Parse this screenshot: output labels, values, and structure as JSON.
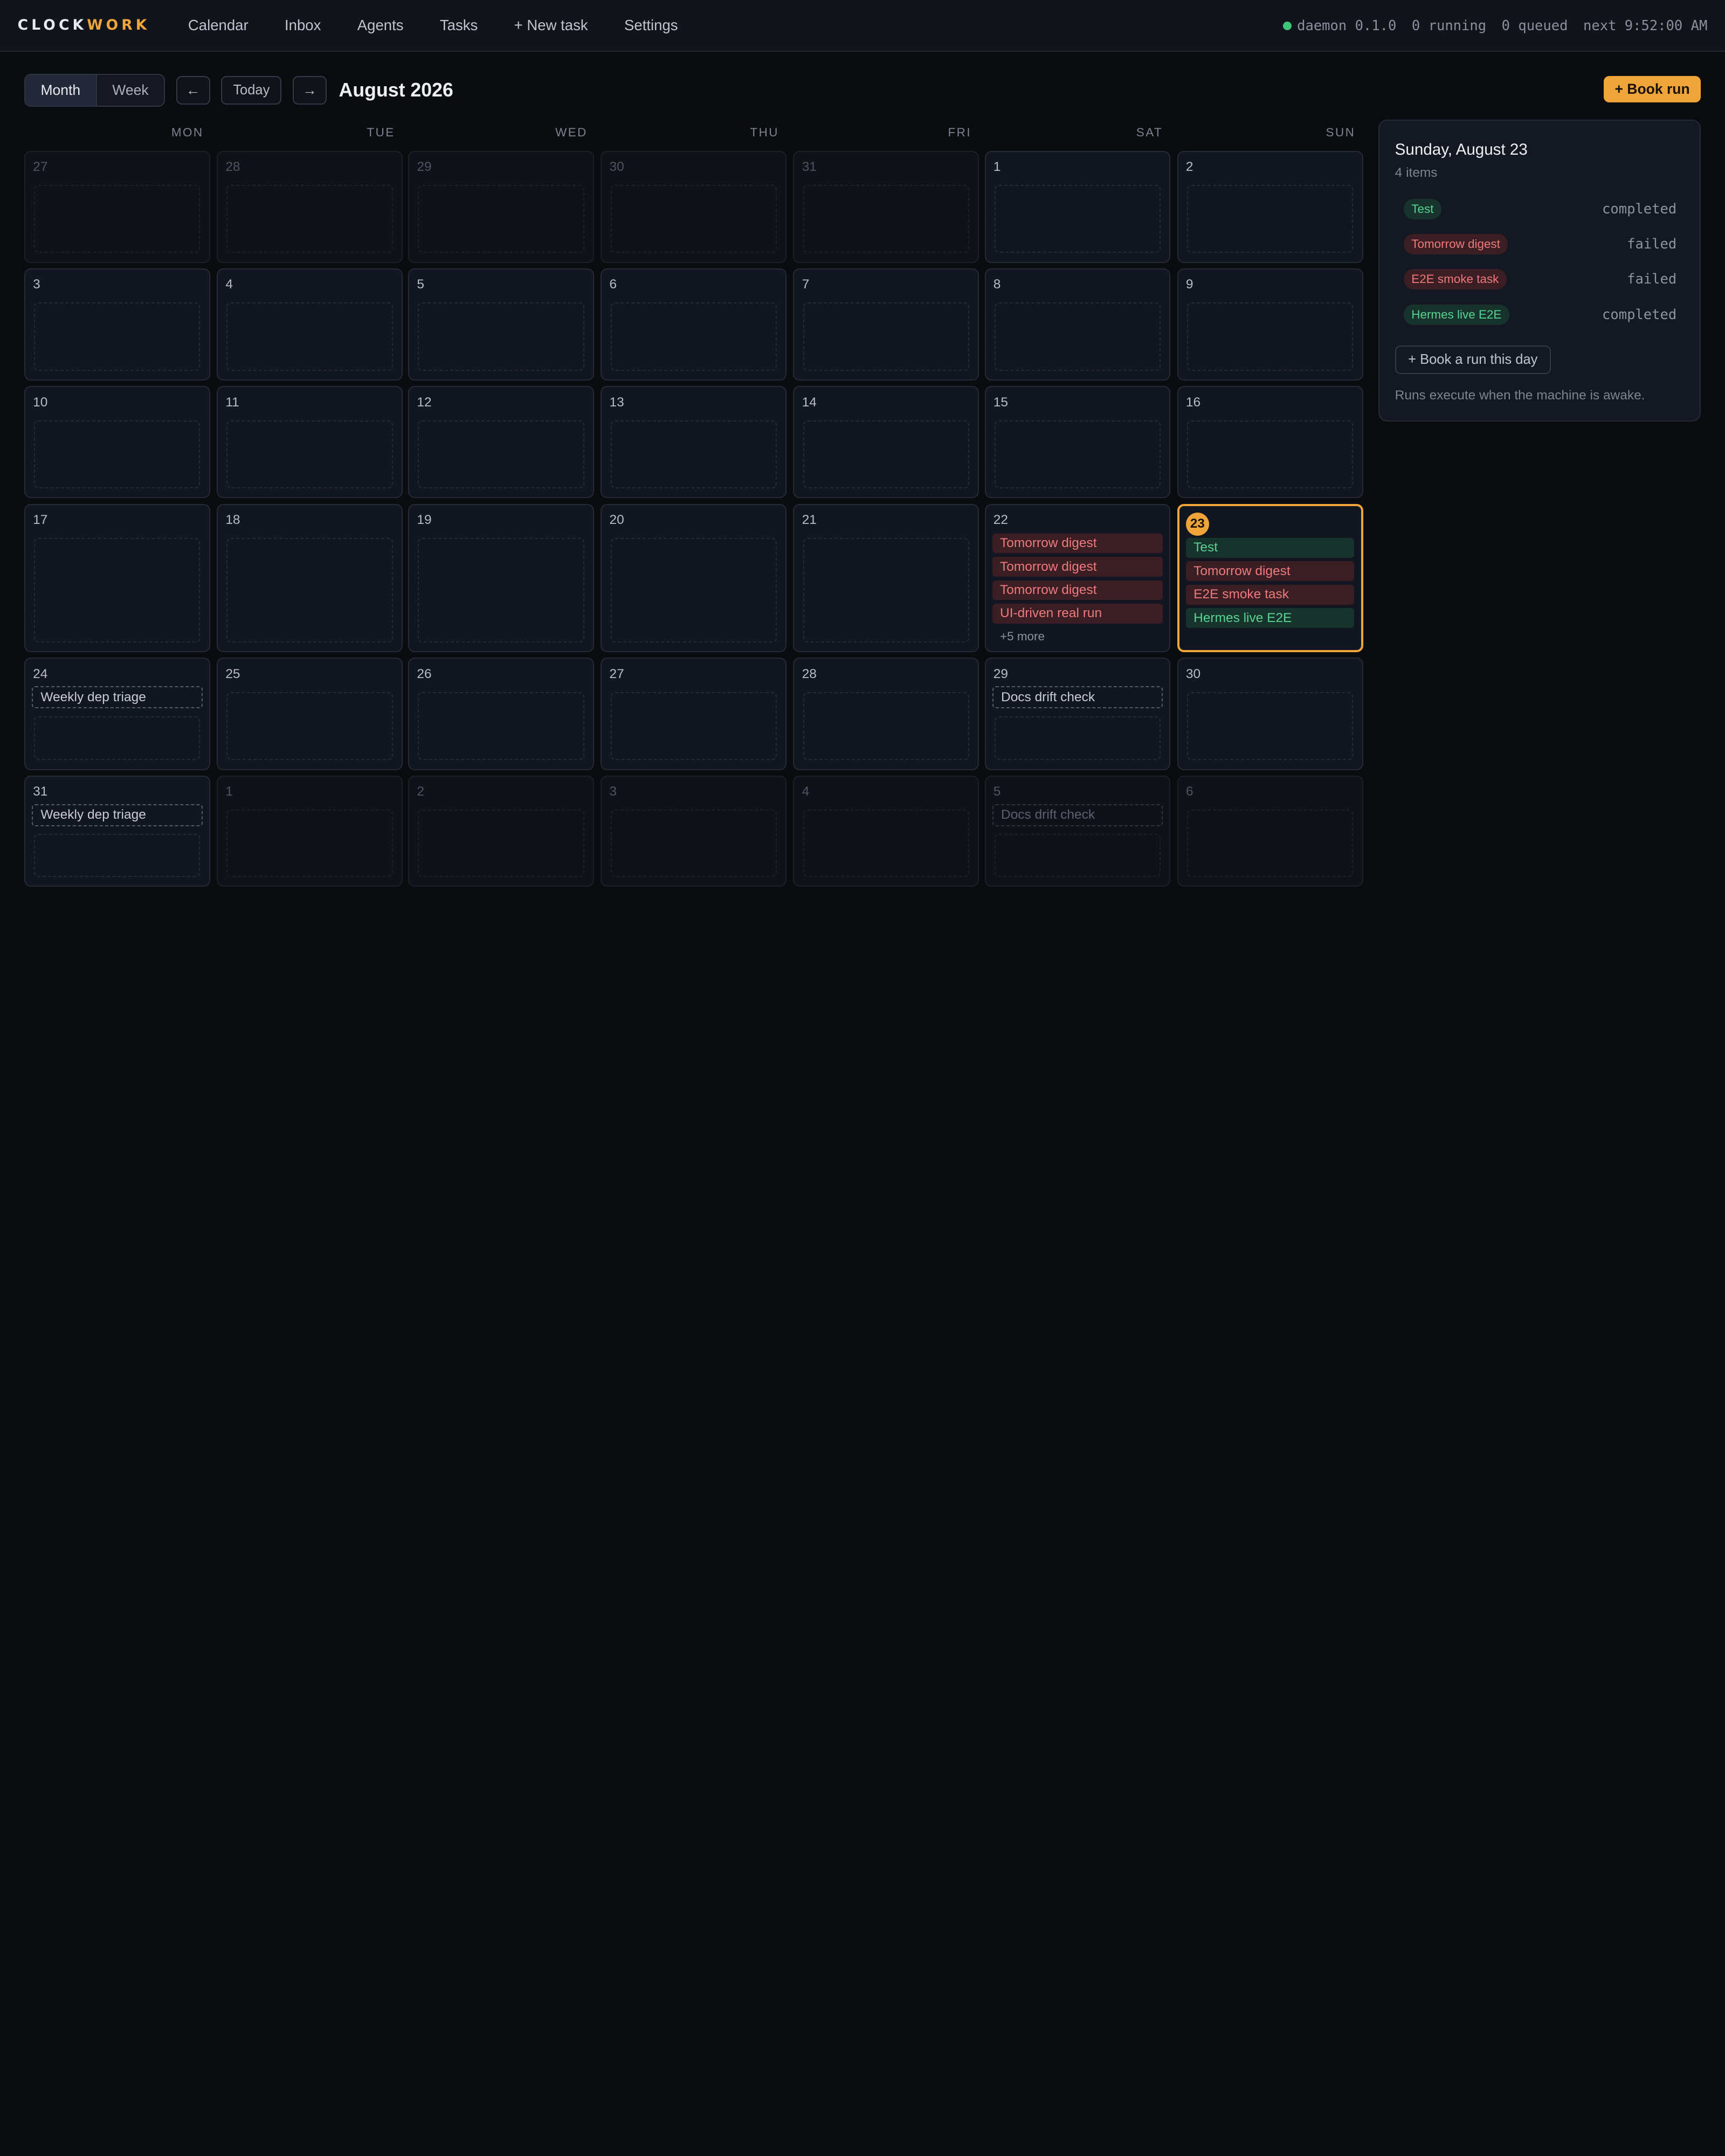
{
  "app": {
    "logo_part1": "CLOCK",
    "logo_part2": "WORK",
    "nav": [
      "Calendar",
      "Inbox",
      "Agents",
      "Tasks",
      "+ New task",
      "Settings"
    ],
    "status": {
      "daemon": "daemon 0.1.0",
      "running": "0 running",
      "queued": "0 queued",
      "next": "next 9:52:00 AM",
      "dot_color": "#3fc27a"
    }
  },
  "toolbar": {
    "view_month": "Month",
    "view_week": "Week",
    "active_view": "Month",
    "prev": "←",
    "today": "Today",
    "next": "→",
    "title": "August 2026",
    "book_run": "+ Book run",
    "accent": "#f0a53a"
  },
  "calendar": {
    "weekdays": [
      "MON",
      "TUE",
      "WED",
      "THU",
      "FRI",
      "SAT",
      "SUN"
    ],
    "more_label": "+5 more",
    "selected_day": "23",
    "weeks": [
      [
        {
          "d": "27",
          "out": true
        },
        {
          "d": "28",
          "out": true
        },
        {
          "d": "29",
          "out": true
        },
        {
          "d": "30",
          "out": true
        },
        {
          "d": "31",
          "out": true
        },
        {
          "d": "1"
        },
        {
          "d": "2"
        }
      ],
      [
        {
          "d": "3"
        },
        {
          "d": "4"
        },
        {
          "d": "5"
        },
        {
          "d": "6"
        },
        {
          "d": "7"
        },
        {
          "d": "8"
        },
        {
          "d": "9"
        }
      ],
      [
        {
          "d": "10"
        },
        {
          "d": "11"
        },
        {
          "d": "12"
        },
        {
          "d": "13"
        },
        {
          "d": "14"
        },
        {
          "d": "15"
        },
        {
          "d": "16"
        }
      ],
      [
        {
          "d": "17"
        },
        {
          "d": "18"
        },
        {
          "d": "19"
        },
        {
          "d": "20"
        },
        {
          "d": "21"
        },
        {
          "d": "22",
          "events": [
            {
              "t": "Tomorrow digest",
              "s": "failed"
            },
            {
              "t": "Tomorrow digest",
              "s": "failed"
            },
            {
              "t": "Tomorrow digest",
              "s": "failed"
            },
            {
              "t": "UI-driven real run",
              "s": "failed"
            }
          ],
          "more": true
        },
        {
          "d": "23",
          "selected": true,
          "events": [
            {
              "t": "Test",
              "s": "completed"
            },
            {
              "t": "Tomorrow digest",
              "s": "failed"
            },
            {
              "t": "E2E smoke task",
              "s": "failed"
            },
            {
              "t": "Hermes live E2E",
              "s": "completed"
            }
          ]
        }
      ],
      [
        {
          "d": "24",
          "events": [
            {
              "t": "Weekly dep triage",
              "s": "scheduled"
            }
          ]
        },
        {
          "d": "25"
        },
        {
          "d": "26"
        },
        {
          "d": "27"
        },
        {
          "d": "28"
        },
        {
          "d": "29",
          "events": [
            {
              "t": "Docs drift check",
              "s": "scheduled"
            }
          ]
        },
        {
          "d": "30"
        }
      ],
      [
        {
          "d": "31",
          "events": [
            {
              "t": "Weekly dep triage",
              "s": "scheduled"
            }
          ]
        },
        {
          "d": "1",
          "out": true
        },
        {
          "d": "2",
          "out": true
        },
        {
          "d": "3",
          "out": true
        },
        {
          "d": "4",
          "out": true
        },
        {
          "d": "5",
          "out": true,
          "events": [
            {
              "t": "Docs drift check",
              "s": "scheduled"
            }
          ]
        },
        {
          "d": "6",
          "out": true
        }
      ]
    ]
  },
  "panel": {
    "title": "Sunday, August 23",
    "count": "4 items",
    "items": [
      {
        "name": "Test",
        "status": "completed"
      },
      {
        "name": "Tomorrow digest",
        "status": "failed"
      },
      {
        "name": "E2E smoke task",
        "status": "failed"
      },
      {
        "name": "Hermes live E2E",
        "status": "completed"
      }
    ],
    "book_day": "+ Book a run this day",
    "note": "Runs execute when the machine is awake."
  }
}
